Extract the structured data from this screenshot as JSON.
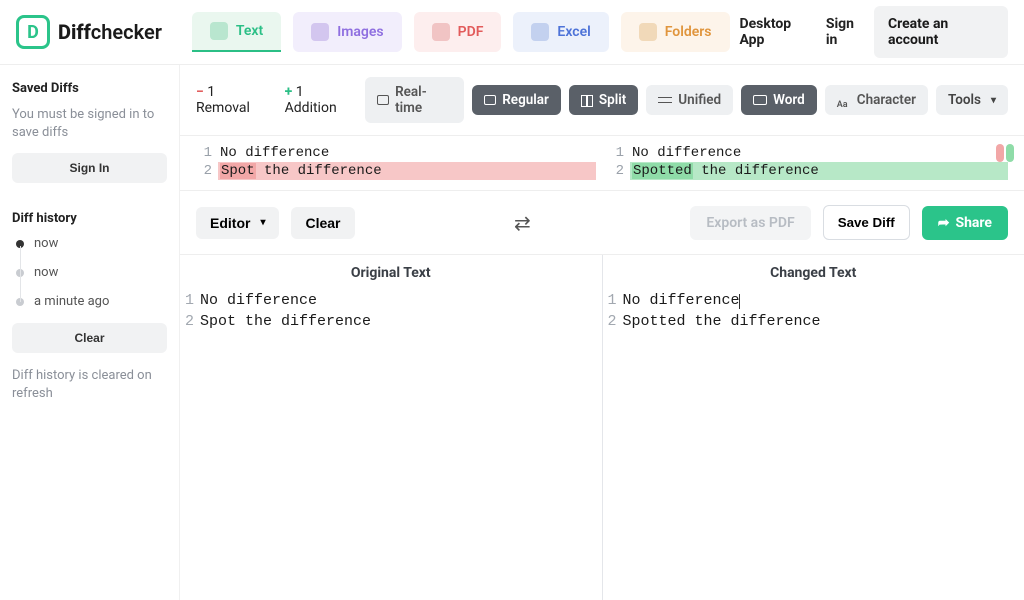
{
  "brand": {
    "bold": "Diff",
    "rest": "checker"
  },
  "tabs": {
    "text": "Text",
    "images": "Images",
    "pdf": "PDF",
    "excel": "Excel",
    "folders": "Folders"
  },
  "header_links": {
    "desktop": "Desktop App",
    "signin": "Sign in",
    "create": "Create an account"
  },
  "sidebar": {
    "saved_title": "Saved Diffs",
    "saved_msg": "You must be signed in to save diffs",
    "signin_btn": "Sign In",
    "history_title": "Diff history",
    "hist_items": [
      "now",
      "now",
      "a minute ago"
    ],
    "clear_btn": "Clear",
    "history_note": "Diff history is cleared on refresh"
  },
  "summary": {
    "removal_count": "1 Removal",
    "addition_count": "1 Addition"
  },
  "modes": {
    "realtime": "Real-time",
    "regular": "Regular",
    "split": "Split",
    "unified": "Unified",
    "word": "Word",
    "character": "Character",
    "tools": "Tools"
  },
  "diff": {
    "left": [
      {
        "n": "1",
        "txt": "No difference",
        "hl": ""
      },
      {
        "n": "2",
        "txt_pre": "",
        "chip": "Spot",
        "txt_post": " the difference",
        "hl": "del"
      }
    ],
    "right": [
      {
        "n": "1",
        "txt": "No difference",
        "hl": ""
      },
      {
        "n": "2",
        "txt_pre": "",
        "chip": "Spotted",
        "txt_post": " the difference",
        "hl": "add"
      }
    ]
  },
  "editor_row": {
    "editor": "Editor",
    "clear": "Clear",
    "export": "Export as PDF",
    "save": "Save Diff",
    "share": "Share"
  },
  "panes": {
    "left_title": "Original Text",
    "right_title": "Changed Text",
    "left_lines": [
      {
        "n": "1",
        "t": "No difference"
      },
      {
        "n": "2",
        "t": "Spot the difference"
      }
    ],
    "right_lines": [
      {
        "n": "1",
        "t": "No difference",
        "cursor": true
      },
      {
        "n": "2",
        "t": "Spotted the difference"
      }
    ]
  }
}
